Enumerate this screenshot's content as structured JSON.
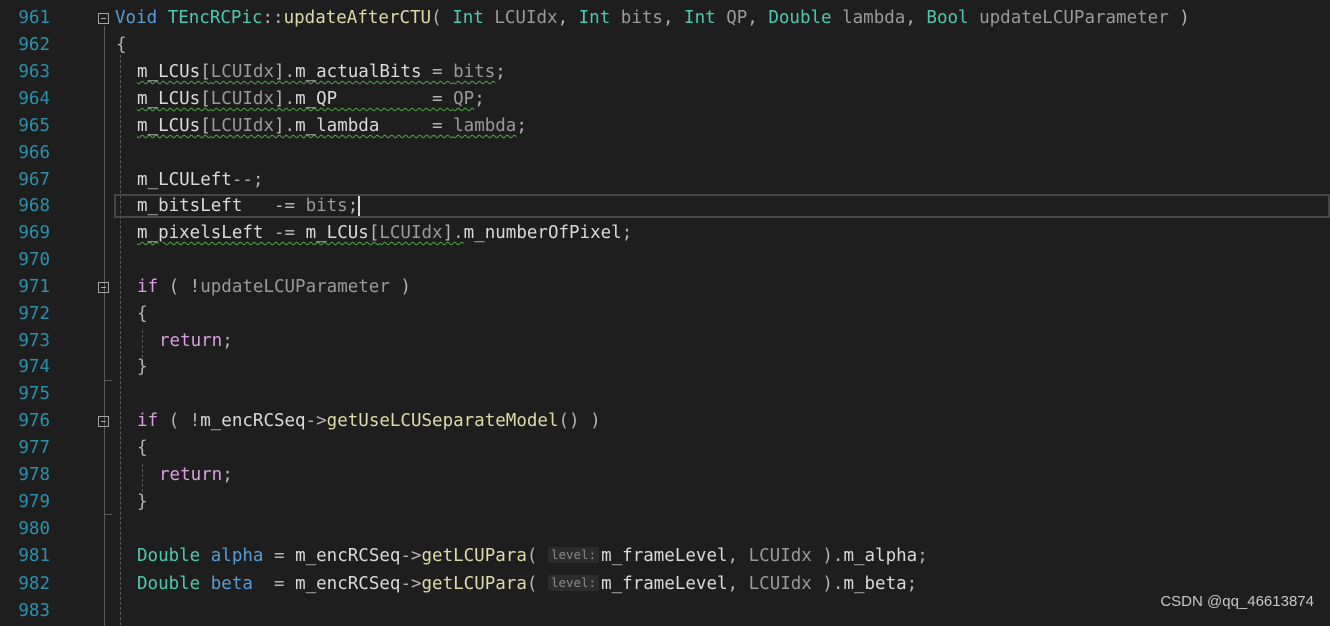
{
  "watermark": "CSDN @qq_46613874",
  "colors": {
    "background": "#1e1e1e",
    "line_number": "#2b91af",
    "keyword": "#569cd6",
    "control": "#d8a0df",
    "type": "#4ec9b0",
    "function": "#dcdcaa",
    "parameter": "#9a9a9a",
    "default": "#dcdcdc"
  },
  "lines": [
    {
      "num": "961",
      "tokens": [
        {
          "t": "Void ",
          "c": "kw"
        },
        {
          "t": "TEncRCPic",
          "c": "class"
        },
        {
          "t": "::",
          "c": "punct"
        },
        {
          "t": "updateAfterCTU",
          "c": "fn"
        },
        {
          "t": "( ",
          "c": "punct"
        },
        {
          "t": "Int ",
          "c": "type"
        },
        {
          "t": "LCUIdx",
          "c": "param"
        },
        {
          "t": ", ",
          "c": "punct"
        },
        {
          "t": "Int ",
          "c": "type"
        },
        {
          "t": "bits",
          "c": "param"
        },
        {
          "t": ", ",
          "c": "punct"
        },
        {
          "t": "Int ",
          "c": "type"
        },
        {
          "t": "QP",
          "c": "param"
        },
        {
          "t": ", ",
          "c": "punct"
        },
        {
          "t": "Double ",
          "c": "type"
        },
        {
          "t": "lambda",
          "c": "param"
        },
        {
          "t": ", ",
          "c": "punct"
        },
        {
          "t": "Bool ",
          "c": "type"
        },
        {
          "t": "updateLCUParameter",
          "c": "param"
        },
        {
          "t": " )",
          "c": "punct"
        }
      ]
    },
    {
      "num": "962",
      "tokens": [
        {
          "t": "{",
          "c": "punct"
        }
      ]
    },
    {
      "num": "963",
      "tokens": [
        {
          "t": "m_LCUs",
          "c": "memb",
          "s": 1
        },
        {
          "t": "[",
          "c": "punct",
          "s": 1
        },
        {
          "t": "LCUIdx",
          "c": "param",
          "s": 1
        },
        {
          "t": "].",
          "c": "punct",
          "s": 1
        },
        {
          "t": "m_actualBits",
          "c": "memb",
          "s": 1
        },
        {
          "t": " = ",
          "c": "punct",
          "s": 1
        },
        {
          "t": "bits",
          "c": "param",
          "s": 1
        },
        {
          "t": ";",
          "c": "punct"
        }
      ]
    },
    {
      "num": "964",
      "tokens": [
        {
          "t": "m_LCUs",
          "c": "memb",
          "s": 1
        },
        {
          "t": "[",
          "c": "punct",
          "s": 1
        },
        {
          "t": "LCUIdx",
          "c": "param",
          "s": 1
        },
        {
          "t": "].",
          "c": "punct",
          "s": 1
        },
        {
          "t": "m_QP",
          "c": "memb",
          "s": 1
        },
        {
          "t": "         = ",
          "c": "punct",
          "s": 1
        },
        {
          "t": "QP",
          "c": "param",
          "s": 1
        },
        {
          "t": ";",
          "c": "punct"
        }
      ]
    },
    {
      "num": "965",
      "tokens": [
        {
          "t": "m_LCUs",
          "c": "memb",
          "s": 1
        },
        {
          "t": "[",
          "c": "punct",
          "s": 1
        },
        {
          "t": "LCUIdx",
          "c": "param",
          "s": 1
        },
        {
          "t": "].",
          "c": "punct",
          "s": 1
        },
        {
          "t": "m_lambda",
          "c": "memb",
          "s": 1
        },
        {
          "t": "     = ",
          "c": "punct",
          "s": 1
        },
        {
          "t": "lambda",
          "c": "param",
          "s": 1
        },
        {
          "t": ";",
          "c": "punct"
        }
      ]
    },
    {
      "num": "966",
      "tokens": []
    },
    {
      "num": "967",
      "tokens": [
        {
          "t": "m_LCULeft",
          "c": "memb"
        },
        {
          "t": "--;",
          "c": "punct"
        }
      ]
    },
    {
      "num": "968",
      "tokens": [
        {
          "t": "m_bitsLeft",
          "c": "memb"
        },
        {
          "t": "   -= ",
          "c": "punct"
        },
        {
          "t": "bits",
          "c": "param"
        },
        {
          "t": ";",
          "c": "punct"
        }
      ],
      "caret": true
    },
    {
      "num": "969",
      "tokens": [
        {
          "t": "m_pixelsLeft",
          "c": "memb",
          "s": 1
        },
        {
          "t": " -= ",
          "c": "punct",
          "s": 1
        },
        {
          "t": "m_LCUs",
          "c": "memb",
          "s": 1
        },
        {
          "t": "[",
          "c": "punct",
          "s": 1
        },
        {
          "t": "LCUIdx",
          "c": "param",
          "s": 1
        },
        {
          "t": "].",
          "c": "punct",
          "s": 1
        },
        {
          "t": "m_numberOfPixel",
          "c": "memb"
        },
        {
          "t": ";",
          "c": "punct"
        }
      ]
    },
    {
      "num": "970",
      "tokens": []
    },
    {
      "num": "971",
      "tokens": [
        {
          "t": "if",
          "c": "ctl"
        },
        {
          "t": " ( !",
          "c": "punct"
        },
        {
          "t": "updateLCUParameter",
          "c": "param"
        },
        {
          "t": " )",
          "c": "punct"
        }
      ]
    },
    {
      "num": "972",
      "tokens": [
        {
          "t": "{",
          "c": "punct"
        }
      ]
    },
    {
      "num": "973",
      "tokens": [
        {
          "t": "return",
          "c": "ctl"
        },
        {
          "t": ";",
          "c": "punct"
        }
      ],
      "indent": 2
    },
    {
      "num": "974",
      "tokens": [
        {
          "t": "}",
          "c": "punct"
        }
      ]
    },
    {
      "num": "975",
      "tokens": []
    },
    {
      "num": "976",
      "tokens": [
        {
          "t": "if",
          "c": "ctl"
        },
        {
          "t": " ( !",
          "c": "punct"
        },
        {
          "t": "m_encRCSeq",
          "c": "memb"
        },
        {
          "t": "->",
          "c": "punct"
        },
        {
          "t": "getUseLCUSeparateModel",
          "c": "fn"
        },
        {
          "t": "() )",
          "c": "punct"
        }
      ]
    },
    {
      "num": "977",
      "tokens": [
        {
          "t": "{",
          "c": "punct"
        }
      ]
    },
    {
      "num": "978",
      "tokens": [
        {
          "t": "return",
          "c": "ctl"
        },
        {
          "t": ";",
          "c": "punct"
        }
      ],
      "indent": 2
    },
    {
      "num": "979",
      "tokens": [
        {
          "t": "}",
          "c": "punct"
        }
      ]
    },
    {
      "num": "980",
      "tokens": []
    },
    {
      "num": "981",
      "tokens": [
        {
          "t": "Double ",
          "c": "type"
        },
        {
          "t": "alpha",
          "c": "kw2"
        },
        {
          "t": " = ",
          "c": "punct"
        },
        {
          "t": "m_encRCSeq",
          "c": "memb"
        },
        {
          "t": "->",
          "c": "punct"
        },
        {
          "t": "getLCUPara",
          "c": "fn"
        },
        {
          "t": "( ",
          "c": "punct"
        },
        {
          "t": "level:",
          "c": "hint"
        },
        {
          "t": "m_frameLevel",
          "c": "memb"
        },
        {
          "t": ", ",
          "c": "punct"
        },
        {
          "t": "LCUIdx",
          "c": "param"
        },
        {
          "t": " ).",
          "c": "punct"
        },
        {
          "t": "m_alpha",
          "c": "memb"
        },
        {
          "t": ";",
          "c": "punct"
        }
      ]
    },
    {
      "num": "982",
      "tokens": [
        {
          "t": "Double ",
          "c": "type"
        },
        {
          "t": "beta",
          "c": "kw2"
        },
        {
          "t": "  = ",
          "c": "punct"
        },
        {
          "t": "m_encRCSeq",
          "c": "memb"
        },
        {
          "t": "->",
          "c": "punct"
        },
        {
          "t": "getLCUPara",
          "c": "fn"
        },
        {
          "t": "( ",
          "c": "punct"
        },
        {
          "t": "level:",
          "c": "hint"
        },
        {
          "t": "m_frameLevel",
          "c": "memb"
        },
        {
          "t": ", ",
          "c": "punct"
        },
        {
          "t": "LCUIdx",
          "c": "param"
        },
        {
          "t": " ).",
          "c": "punct"
        },
        {
          "t": "m_beta",
          "c": "memb"
        },
        {
          "t": ";",
          "c": "punct"
        }
      ]
    },
    {
      "num": "983",
      "tokens": []
    }
  ]
}
